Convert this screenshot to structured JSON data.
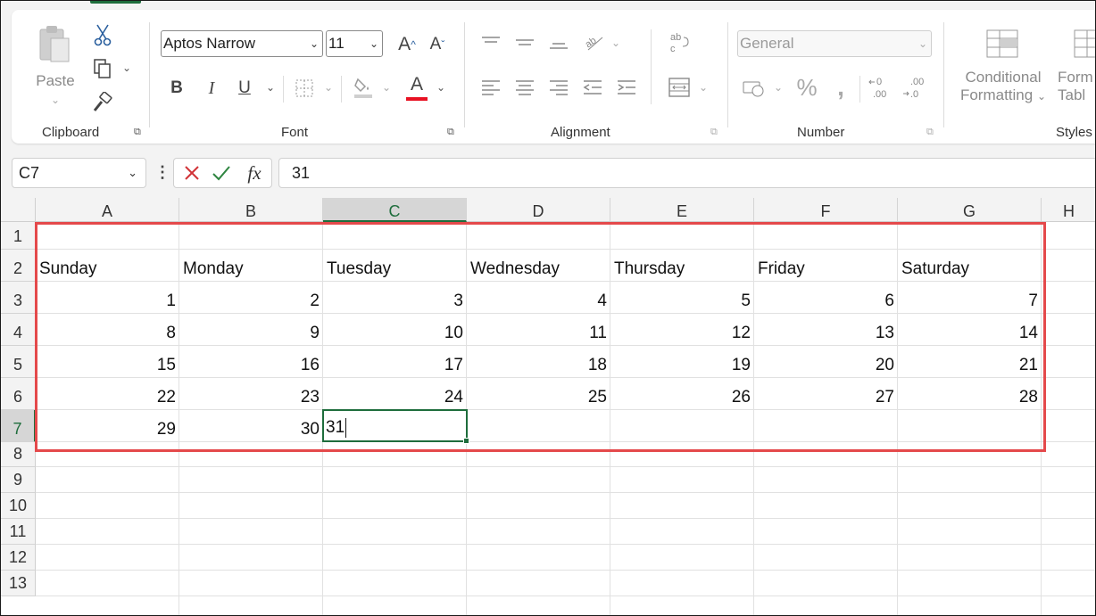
{
  "ribbon": {
    "clipboard": {
      "paste_label": "Paste",
      "group_label": "Clipboard"
    },
    "font": {
      "font_name": "Aptos Narrow",
      "font_size": "11",
      "group_label": "Font",
      "bold": "B",
      "italic": "I",
      "underline": "U",
      "grow": "A",
      "shrink": "A",
      "font_color": "A"
    },
    "alignment": {
      "group_label": "Alignment"
    },
    "number": {
      "format": "General",
      "group_label": "Number"
    },
    "styles": {
      "conditional_line1": "Conditional",
      "conditional_line2": "Formatting",
      "format_table_line1": "Form",
      "format_table_line2": "Tabl",
      "group_label": "Styles"
    }
  },
  "formula_bar": {
    "name_box": "C7",
    "formula": "31"
  },
  "grid": {
    "columns": [
      "A",
      "B",
      "C",
      "D",
      "E",
      "F",
      "G",
      "H"
    ],
    "active_column": "C",
    "rows": [
      "1",
      "2",
      "3",
      "4",
      "5",
      "6",
      "7",
      "8",
      "9",
      "10",
      "11",
      "12",
      "13"
    ],
    "active_row": "7",
    "headers": [
      "Sunday",
      "Monday",
      "Tuesday",
      "Wednesday",
      "Thursday",
      "Friday",
      "Saturday"
    ],
    "weeks": [
      [
        "1",
        "2",
        "3",
        "4",
        "5",
        "6",
        "7"
      ],
      [
        "8",
        "9",
        "10",
        "11",
        "12",
        "13",
        "14"
      ],
      [
        "15",
        "16",
        "17",
        "18",
        "19",
        "20",
        "21"
      ],
      [
        "22",
        "23",
        "24",
        "25",
        "26",
        "27",
        "28"
      ],
      [
        "29",
        "30",
        "",
        "",
        "",
        "",
        ""
      ]
    ],
    "editing_cell": {
      "ref": "C7",
      "value": "31"
    }
  },
  "colors": {
    "accent": "#1e6d3c",
    "highlight_box": "#e4494b",
    "font_color_bar": "#e81123"
  }
}
